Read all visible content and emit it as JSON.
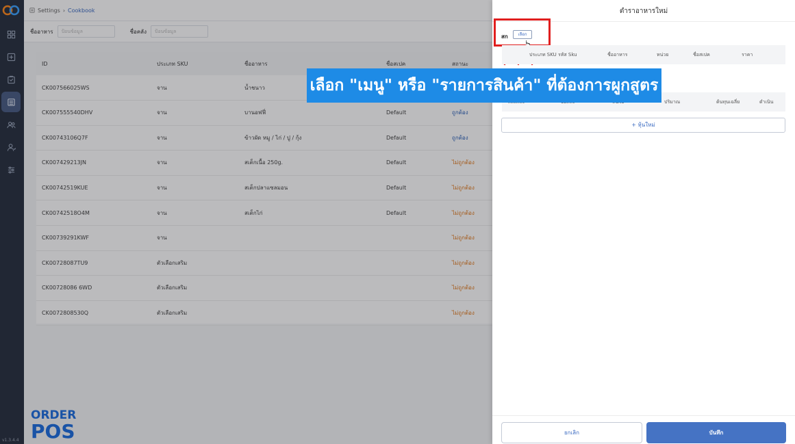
{
  "nav": {
    "version": "v1.3.4.4",
    "items": [
      "dashboard-icon",
      "pos-icon",
      "orders-icon",
      "cookbook-icon",
      "customers-icon",
      "users-icon",
      "settings-icon"
    ],
    "active_index": 3
  },
  "breadcrumb": {
    "root": "Settings",
    "current": "Cookbook"
  },
  "filters": [
    {
      "label": "ชื่ออาหาร",
      "placeholder": "ป้อนข้อมูล"
    },
    {
      "label": "ชื่อคลัง",
      "placeholder": "ป้อนข้อมูล"
    }
  ],
  "table": {
    "headers": [
      "ID",
      "ประเภท SKU",
      "ชื่ออาหาร",
      "ชื่อสเปค",
      "สถานะ"
    ],
    "rows": [
      {
        "id": "CK007566025WS",
        "sku_type": "จาน",
        "name": "น้ำชนาว",
        "variant": "",
        "status": "ถูกต้อง",
        "ok": true
      },
      {
        "id": "CK007555540DHV",
        "sku_type": "จาน",
        "name": "บานอฟฟี่",
        "variant": "Default",
        "status": "ถูกต้อง",
        "ok": true
      },
      {
        "id": "CK00743106Q7F",
        "sku_type": "จาน",
        "name": "ข้าวผัด หมู / ไก่ / ปู / กุ้ง",
        "variant": "Default",
        "status": "ถูกต้อง",
        "ok": true
      },
      {
        "id": "CK007429213JN",
        "sku_type": "จาน",
        "name": "สเต็กเนื้อ 250g.",
        "variant": "Default",
        "status": "ไม่ถูกต้อง",
        "ok": false
      },
      {
        "id": "CK00742519KUE",
        "sku_type": "จาน",
        "name": "สเต็กปลาแซลมอน",
        "variant": "Default",
        "status": "ไม่ถูกต้อง",
        "ok": false
      },
      {
        "id": "CK00742518O4M",
        "sku_type": "จาน",
        "name": "สเต็กไก่",
        "variant": "Default",
        "status": "ไม่ถูกต้อง",
        "ok": false
      },
      {
        "id": "CK00739291KWF",
        "sku_type": "จาน",
        "name": "",
        "variant": "",
        "status": "ไม่ถูกต้อง",
        "ok": false
      },
      {
        "id": "CK00728087TU9",
        "sku_type": "ตัวเลือกเสริม",
        "name": "",
        "variant": "",
        "status": "ไม่ถูกต้อง",
        "ok": false
      },
      {
        "id": "CK00728086 6WD",
        "sku_type": "ตัวเลือกเสริม",
        "name": "",
        "variant": "",
        "status": "ไม่ถูกต้อง",
        "ok": false
      },
      {
        "id": "CK0072808530Q",
        "sku_type": "ตัวเลือกเสริม",
        "name": "",
        "variant": "",
        "status": "ไม่ถูกต้อง",
        "ok": false
      }
    ]
  },
  "drawer": {
    "title": "ตำราอาหารใหม่",
    "food_label": "สก",
    "pick_label": "เลือก",
    "product_headers": [
      "ประเภท SKU",
      "รหัส Sku",
      "ชื่ออาหาร",
      "หน่วย",
      "ชื่อสเปค",
      "ราคา"
    ],
    "ingredient_headers": [
      "รหัสคลัง",
      "ชื่อคลัง",
      "หน่วย",
      "ปริมาณ",
      "ต้นทุนเฉลี่ย",
      "ดำเนิน"
    ],
    "add_label": "+ หุ้นใหม่",
    "cancel_label": "ยกเลิก",
    "save_label": "บันทึก"
  },
  "banner": {
    "text": "เลือก \"เมนู\" หรือ \"รายการสินค้า\" ที่ต้องการผูกสูตร"
  },
  "brand": {
    "line1": "ORDER",
    "line2": "POS"
  },
  "colors": {
    "accent": "#3d6cc2",
    "primary": "#4573c4",
    "warning": "#e07a1f",
    "banner": "#1e8be6",
    "highlight": "#e01e1e",
    "rail": "#2a3342"
  }
}
